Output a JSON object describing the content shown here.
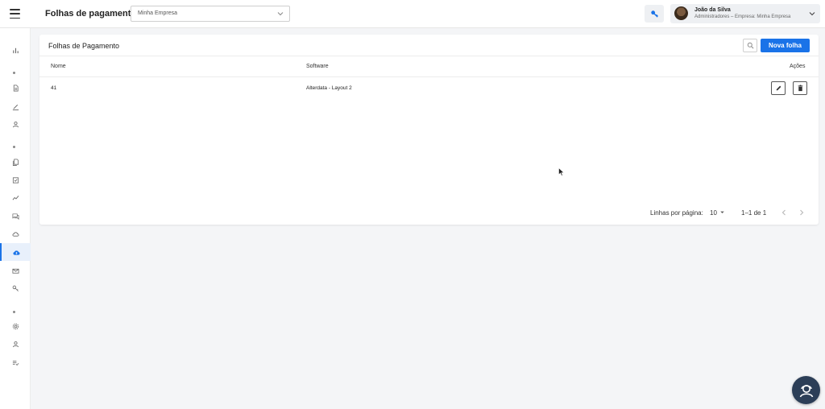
{
  "header": {
    "title": "Folhas de pagamento",
    "company_select": {
      "value": "Minha Empresa"
    },
    "key_icon": "key-icon",
    "user": {
      "name": "João da Silva",
      "role": "Administradores – Empresa: Minha Empresa"
    }
  },
  "sidebar": {
    "items": [
      {
        "icon": "bar-chart-icon"
      },
      {
        "icon": "document-icon"
      },
      {
        "icon": "pen-icon"
      },
      {
        "icon": "user-icon"
      },
      {
        "icon": "copy-icon"
      },
      {
        "icon": "checklist-icon"
      },
      {
        "icon": "trend-icon"
      },
      {
        "icon": "chat-icon"
      },
      {
        "icon": "cloud-sync-icon"
      },
      {
        "icon": "cloud-upload-icon",
        "active": true
      },
      {
        "icon": "mail-icon"
      },
      {
        "icon": "key-icon"
      },
      {
        "icon": "settings-icon"
      },
      {
        "icon": "person-icon"
      },
      {
        "icon": "list-check-icon"
      }
    ]
  },
  "card": {
    "title": "Folhas de Pagamento",
    "new_button": "Nova folha",
    "columns": {
      "name": "Nome",
      "software": "Software",
      "actions": "Ações"
    },
    "rows": [
      {
        "name": "41",
        "software": "Alterdata - Layout 2"
      }
    ],
    "pagination": {
      "label": "Linhas por página:",
      "page_size": "10",
      "range": "1–1 de 1"
    }
  },
  "colors": {
    "accent": "#1a73e8",
    "fab": "#2c3e57"
  }
}
